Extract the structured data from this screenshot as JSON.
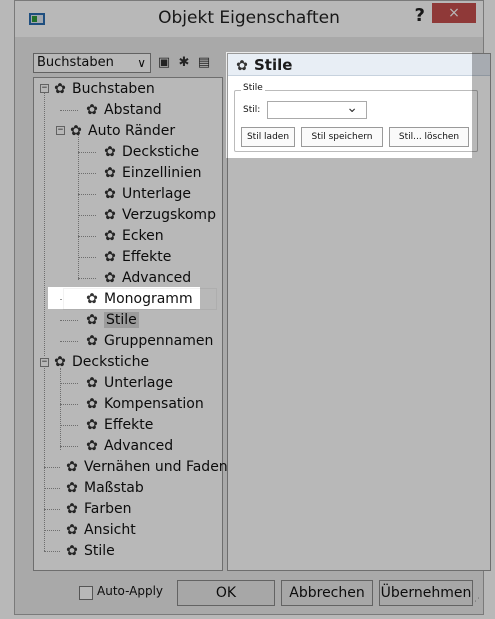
{
  "window": {
    "title": "Objekt Eigenschaften",
    "help_label": "?",
    "close_label": "×"
  },
  "toolbar": {
    "combo_value": "Buchstaben",
    "icons": [
      "save-icon",
      "copy-properties-icon",
      "paste-properties-icon"
    ]
  },
  "tree": {
    "items": [
      {
        "label": "Buchstaben"
      },
      {
        "label": "Abstand"
      },
      {
        "label": "Auto Ränder"
      },
      {
        "label": "Deckstiche"
      },
      {
        "label": "Einzellinien"
      },
      {
        "label": "Unterlage"
      },
      {
        "label": "Verzugskomp"
      },
      {
        "label": "Ecken"
      },
      {
        "label": "Effekte"
      },
      {
        "label": "Advanced"
      },
      {
        "label": "Monogramm"
      },
      {
        "label": "Stile"
      },
      {
        "label": "Gruppennamen"
      },
      {
        "label": "Deckstiche"
      },
      {
        "label": "Unterlage"
      },
      {
        "label": "Kompensation"
      },
      {
        "label": "Effekte"
      },
      {
        "label": "Advanced"
      },
      {
        "label": "Vernähen und Fadens"
      },
      {
        "label": "Maßstab"
      },
      {
        "label": "Farben"
      },
      {
        "label": "Ansicht"
      },
      {
        "label": "Stile"
      }
    ]
  },
  "panel": {
    "header": "Stile",
    "group_title": "Stile",
    "stil_label": "Stil:",
    "stil_value": "",
    "buttons": {
      "load": "Stil laden",
      "save": "Stil speichern",
      "delete": "Stil... löschen"
    }
  },
  "footer": {
    "auto_apply_label": "Auto-Apply",
    "auto_apply_checked": false,
    "ok_label": "OK",
    "cancel_label": "Abbrechen",
    "apply_label": "Übernehmen"
  }
}
